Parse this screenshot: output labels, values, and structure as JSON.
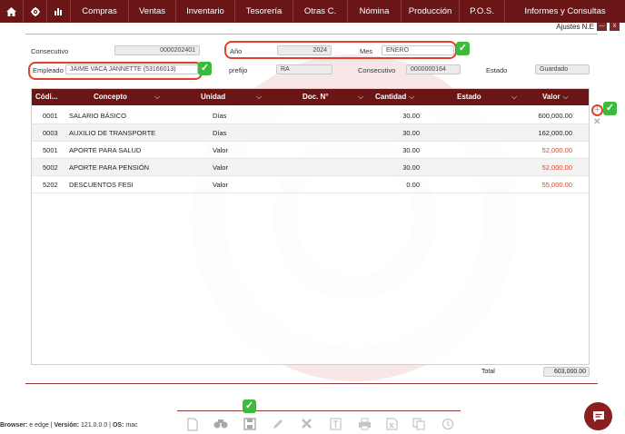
{
  "menu": {
    "items": [
      "Compras",
      "Ventas",
      "Inventario",
      "Tesorería",
      "Otras C.",
      "Nómina",
      "Producción",
      "P.O.S.",
      "Informes y Consultas"
    ]
  },
  "window": {
    "title": "Ajustes N.E",
    "minimize": "—",
    "close": "X"
  },
  "form": {
    "consecutivo_label": "Consecutivo",
    "consecutivo_value": "0000202401",
    "anio_label": "Año",
    "anio_value": "2024",
    "mes_label": "Mes",
    "mes_value": "ENERO",
    "empleado_label": "Empleado",
    "empleado_value": "JAIME VACA JANNETTE (53166013)",
    "prefijo_label": "prefijo",
    "prefijo_value": "RA",
    "consecutivo2_label": "Consecutivo",
    "consecutivo2_value": "0000000164",
    "estado_label": "Estado",
    "estado_value": "Guardado"
  },
  "table": {
    "headers": {
      "codigo": "Códi...",
      "concepto": "Concepto",
      "unidad": "Unidad",
      "doc": "Doc. N°",
      "cantidad": "Cantidad",
      "estado": "Estado",
      "valor": "Valor"
    },
    "rows": [
      {
        "codigo": "0001",
        "concepto": "SALARIO BÁSICO",
        "unidad": "Días",
        "cantidad": "30.00",
        "valor": "600,000.00",
        "negative": false
      },
      {
        "codigo": "0003",
        "concepto": "AUXILIO DE TRANSPORTE",
        "unidad": "Días",
        "cantidad": "30.00",
        "valor": "162,000.00",
        "negative": false
      },
      {
        "codigo": "5001",
        "concepto": "APORTE PARA SALUD",
        "unidad": "Valor",
        "cantidad": "30.00",
        "valor": "52,000.00",
        "negative": true
      },
      {
        "codigo": "5002",
        "concepto": "APORTE PARA PENSIÓN",
        "unidad": "Valor",
        "cantidad": "30.00",
        "valor": "52,000.00",
        "negative": true
      },
      {
        "codigo": "5202",
        "concepto": "DESCUENTOS FESI",
        "unidad": "Valor",
        "cantidad": "0.00",
        "valor": "55,000.00",
        "negative": true
      }
    ]
  },
  "total": {
    "label": "Total",
    "value": "603,000.00"
  },
  "footer": {
    "browser_label": "Browser:",
    "browser_value": "edge",
    "version_label": "Versión:",
    "version_value": "121.0.0.0",
    "os_label": "OS:",
    "os_value": "mac"
  },
  "colors": {
    "brand": "#6b1616",
    "highlight": "#e0402c",
    "ok": "#3cba3c",
    "negative": "#e0402c"
  }
}
